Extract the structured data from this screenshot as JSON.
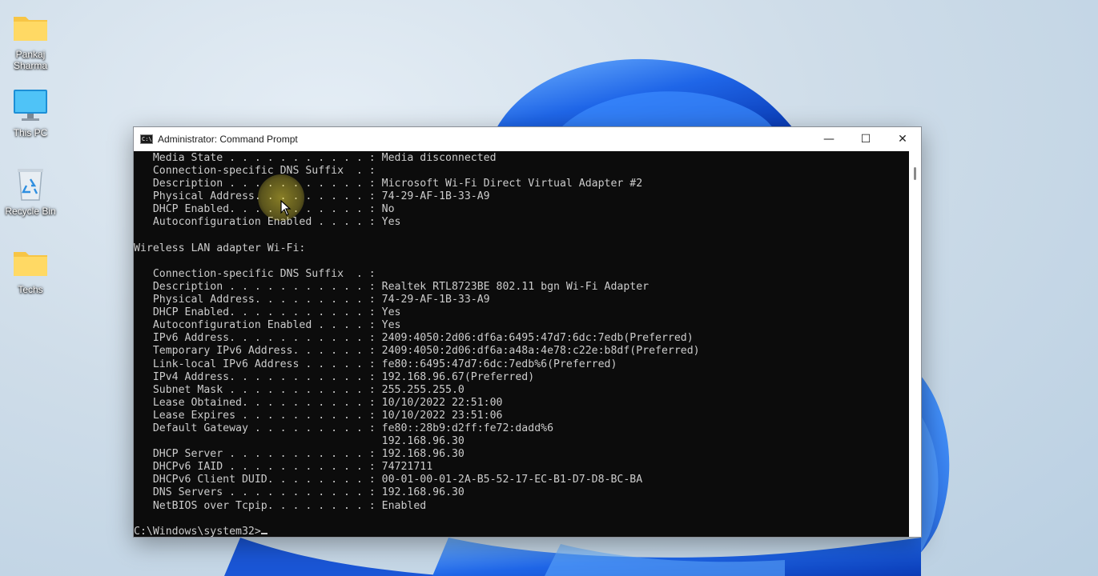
{
  "desktop": {
    "icons": [
      {
        "label": "Pankaj Sharma",
        "icon": "folder-icon"
      },
      {
        "label": "This PC",
        "icon": "monitor-icon"
      },
      {
        "label": "Recycle Bin",
        "icon": "recycle-bin-icon"
      },
      {
        "label": "Techs",
        "icon": "folder-icon"
      }
    ]
  },
  "window": {
    "title": "Administrator: Command Prompt",
    "app_icon_text": "C:\\",
    "controls": {
      "minimize": "—",
      "maximize": "☐",
      "close": "✕"
    }
  },
  "console": {
    "lines": [
      "   Media State . . . . . . . . . . . : Media disconnected",
      "   Connection-specific DNS Suffix  . :",
      "   Description . . . . . . . . . . . : Microsoft Wi-Fi Direct Virtual Adapter #2",
      "   Physical Address. . . . . . . . . : 74-29-AF-1B-33-A9",
      "   DHCP Enabled. . . . . . . . . . . : No",
      "   Autoconfiguration Enabled . . . . : Yes",
      "",
      "Wireless LAN adapter Wi-Fi:",
      "",
      "   Connection-specific DNS Suffix  . :",
      "   Description . . . . . . . . . . . : Realtek RTL8723BE 802.11 bgn Wi-Fi Adapter",
      "   Physical Address. . . . . . . . . : 74-29-AF-1B-33-A9",
      "   DHCP Enabled. . . . . . . . . . . : Yes",
      "   Autoconfiguration Enabled . . . . : Yes",
      "   IPv6 Address. . . . . . . . . . . : 2409:4050:2d06:df6a:6495:47d7:6dc:7edb(Preferred)",
      "   Temporary IPv6 Address. . . . . . : 2409:4050:2d06:df6a:a48a:4e78:c22e:b8df(Preferred)",
      "   Link-local IPv6 Address . . . . . : fe80::6495:47d7:6dc:7edb%6(Preferred)",
      "   IPv4 Address. . . . . . . . . . . : 192.168.96.67(Preferred)",
      "   Subnet Mask . . . . . . . . . . . : 255.255.255.0",
      "   Lease Obtained. . . . . . . . . . : 10/10/2022 22:51:00",
      "   Lease Expires . . . . . . . . . . : 10/10/2022 23:51:06",
      "   Default Gateway . . . . . . . . . : fe80::28b9:d2ff:fe72:dadd%6",
      "                                       192.168.96.30",
      "   DHCP Server . . . . . . . . . . . : 192.168.96.30",
      "   DHCPv6 IAID . . . . . . . . . . . : 74721711",
      "   DHCPv6 Client DUID. . . . . . . . : 00-01-00-01-2A-B5-52-17-EC-B1-D7-D8-BC-BA",
      "   DNS Servers . . . . . . . . . . . : 192.168.96.30",
      "   NetBIOS over Tcpip. . . . . . . . : Enabled",
      ""
    ],
    "prompt": "C:\\Windows\\system32>"
  },
  "colors": {
    "console_bg": "#0c0c0c",
    "console_text": "#cccccc",
    "titlebar_bg": "#ffffff",
    "bloom_blue": "#1e5fe0"
  }
}
